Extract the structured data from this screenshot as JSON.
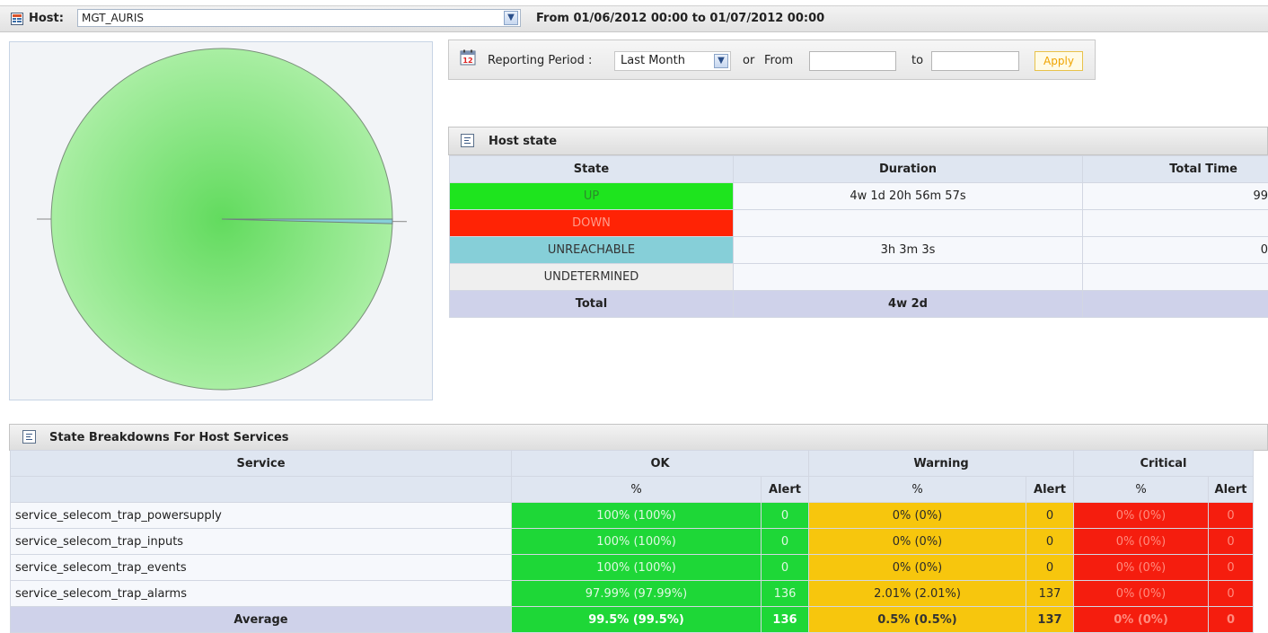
{
  "header": {
    "host_label": "Host:",
    "host_value": "MGT_AURIS",
    "period_range": "From 01/06/2012 00:00 to 01/07/2012 00:00",
    "icons": {
      "host": "report-icon",
      "dropdown": "chevron-down-icon"
    }
  },
  "reporting": {
    "label": "Reporting Period :",
    "period_value": "Last Month",
    "or_label": "or",
    "from_label": "From",
    "from_value": "",
    "to_label": "to",
    "to_value": "",
    "apply_label": "Apply",
    "icon": "calendar-icon"
  },
  "pie": {
    "slices": [
      {
        "state": "UP",
        "fraction": 0.9957,
        "color": "#6ee36e"
      },
      {
        "state": "UNREACHABLE",
        "fraction": 0.0043,
        "color": "#86cfd8"
      }
    ]
  },
  "host_state": {
    "title": "Host state",
    "icon": "document-icon",
    "columns": [
      "State",
      "Duration",
      "Total Time"
    ],
    "rows": [
      {
        "state": "UP",
        "duration": "4w 1d 20h 56m 57s",
        "total_time": "99",
        "color": "#1ee41e",
        "text_color": "#2c8a2c"
      },
      {
        "state": "DOWN",
        "duration": "",
        "total_time": "",
        "color": "#ff2305",
        "text_color": "#ff9a8a"
      },
      {
        "state": "UNREACHABLE",
        "duration": "3h 3m 3s",
        "total_time": "0",
        "color": "#86cfd8",
        "text_color": "#333333"
      },
      {
        "state": "UNDETERMINED",
        "duration": "",
        "total_time": "",
        "color": "#efefef",
        "text_color": "#333333"
      }
    ],
    "total": {
      "label": "Total",
      "duration": "4w 2d",
      "total_time": ""
    }
  },
  "services": {
    "title": "State Breakdowns For Host Services",
    "icon": "document-icon",
    "group_headers": {
      "service": "Service",
      "ok": "OK",
      "warning": "Warning",
      "critical": "Critical"
    },
    "sub_headers": {
      "pct": "%",
      "alert": "Alert"
    },
    "rows": [
      {
        "name": "service_selecom_trap_powersupply",
        "ok_pct": "100% (100%)",
        "ok_alert": "0",
        "warn_pct": "0% (0%)",
        "warn_alert": "0",
        "crit_pct": "0% (0%)",
        "crit_alert": "0"
      },
      {
        "name": "service_selecom_trap_inputs",
        "ok_pct": "100% (100%)",
        "ok_alert": "0",
        "warn_pct": "0% (0%)",
        "warn_alert": "0",
        "crit_pct": "0% (0%)",
        "crit_alert": "0"
      },
      {
        "name": "service_selecom_trap_events",
        "ok_pct": "100% (100%)",
        "ok_alert": "0",
        "warn_pct": "0% (0%)",
        "warn_alert": "0",
        "crit_pct": "0% (0%)",
        "crit_alert": "0"
      },
      {
        "name": "service_selecom_trap_alarms",
        "ok_pct": "97.99% (97.99%)",
        "ok_alert": "136",
        "warn_pct": "2.01% (2.01%)",
        "warn_alert": "137",
        "crit_pct": "0% (0%)",
        "crit_alert": "0"
      }
    ],
    "average": {
      "label": "Average",
      "ok_pct": "99.5% (99.5%)",
      "ok_alert": "136",
      "warn_pct": "0.5% (0.5%)",
      "warn_alert": "137",
      "crit_pct": "0% (0%)",
      "crit_alert": "0"
    },
    "colors": {
      "ok": "#1ed737",
      "warning": "#f7c60d",
      "critical": "#f51d0e"
    }
  }
}
